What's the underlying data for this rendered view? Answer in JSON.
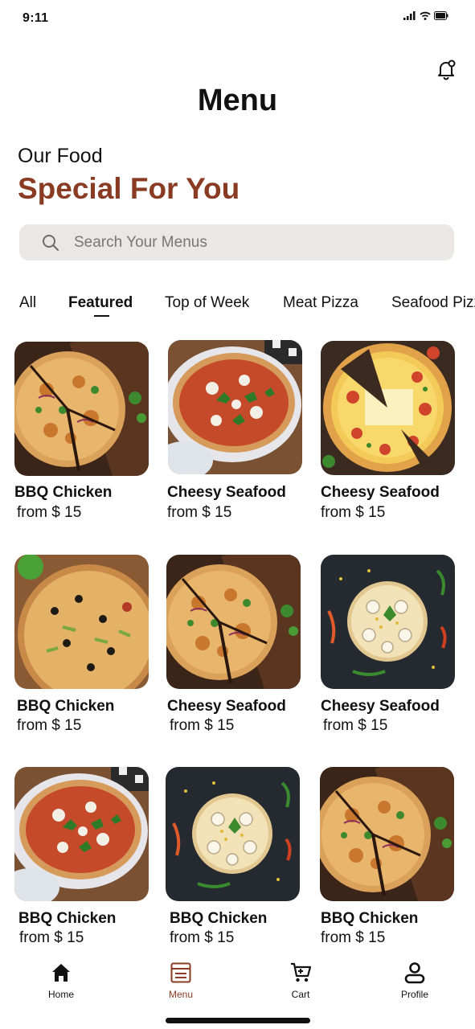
{
  "status_bar": {
    "time": "9:11"
  },
  "header": {
    "title": "Menu"
  },
  "intro": {
    "subtitle": "Our Food",
    "headline": "Special For You"
  },
  "search": {
    "placeholder": "Search Your Menus",
    "value": ""
  },
  "tabs": [
    {
      "label": "All",
      "active": false
    },
    {
      "label": "Featured",
      "active": true
    },
    {
      "label": "Top of Week",
      "active": false
    },
    {
      "label": "Meat Pizza",
      "active": false
    },
    {
      "label": "Seafood Pizza",
      "active": false
    }
  ],
  "items": [
    {
      "name": "BBQ Chicken",
      "price": "from $ 15",
      "image": "sliced-pizza-board"
    },
    {
      "name": "Cheesy Seafood",
      "price": "from $ 15",
      "image": "pizza-plate"
    },
    {
      "name": "Cheesy Seafood",
      "price": "from $ 15",
      "image": "pizza-illustration"
    },
    {
      "name": "BBQ Chicken",
      "price": "from $ 15",
      "image": "olive-pizza"
    },
    {
      "name": "Cheesy Seafood",
      "price": "from $ 15",
      "image": "sliced-pizza-board"
    },
    {
      "name": "Cheesy Seafood",
      "price": "from $ 15",
      "image": "mushroom-pizza"
    },
    {
      "name": "BBQ Chicken",
      "price": "from $ 15",
      "image": "pizza-plate"
    },
    {
      "name": "BBQ Chicken",
      "price": "from $ 15",
      "image": "mushroom-pizza"
    },
    {
      "name": "BBQ Chicken",
      "price": "from $ 15",
      "image": "sliced-pizza-board"
    }
  ],
  "nav": [
    {
      "label": "Home",
      "icon": "home-icon",
      "active": false
    },
    {
      "label": "Menu",
      "icon": "menu-icon",
      "active": true
    },
    {
      "label": "Cart",
      "icon": "cart-icon",
      "active": false
    },
    {
      "label": "Profile",
      "icon": "profile-icon",
      "active": false
    }
  ],
  "colors": {
    "accent": "#8a3b23",
    "search_bg": "#eae7e6",
    "text": "#111111"
  }
}
